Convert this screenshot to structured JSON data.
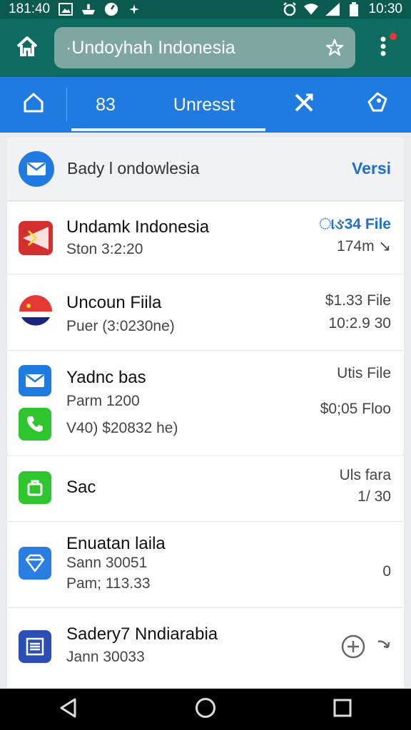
{
  "status_bar": {
    "time_left": "181:40",
    "time_right": "10:30",
    "icons_left": [
      "image-icon",
      "ship-icon",
      "dial-icon",
      "sparkle-icon"
    ],
    "icons_right": [
      "alarm-icon",
      "wifi-icon",
      "signal-icon",
      "battery-icon"
    ]
  },
  "app_bar": {
    "url_text": "·Undoyhah Indonesia",
    "icons": [
      "home-icon",
      "star-icon",
      "more-vert-icon"
    ],
    "accent": "#0d6b60"
  },
  "tabs": [
    {
      "label": ""
    },
    {
      "label": "83"
    },
    {
      "label": "Unresst"
    },
    {
      "label": ""
    },
    {
      "label": ""
    }
  ],
  "header": {
    "title": "Bady l ondowlesia",
    "link": "Versi"
  },
  "rows": [
    {
      "title": "Undamk Indonesia",
      "sub1": "Ston 3:2:20",
      "sub2": "",
      "right1": "ાઙ34 File",
      "right2": "174m ↘"
    },
    {
      "title": "Uncoun Fiila",
      "sub1": "Puer (3:0230ne)",
      "sub2": "",
      "right1": "$1.33 File",
      "right2": "10:2.9 30"
    },
    {
      "title": "Yadnc bas",
      "sub1": "Parm 1200",
      "sub2": "V40) $20832 he)",
      "right1": "Utis File",
      "right2": "$0;05 Floo"
    },
    {
      "title": "Sac",
      "sub1": "",
      "sub2": "",
      "right1": "Uls fara",
      "right2": "1/ 30"
    },
    {
      "title": "Enuatan laila",
      "sub1": "Sann 30051",
      "sub2": "Pam; 113.33",
      "right1": "0",
      "right2": ""
    },
    {
      "title": "Sadery7 Nndiarabia",
      "sub1": "Jann 30033",
      "sub2": "",
      "right1": "",
      "right2": ""
    }
  ],
  "colors": {
    "status_bar": "#0b5a50",
    "tab_bar": "#1f7be0",
    "link_blue": "#1f6fd0"
  }
}
